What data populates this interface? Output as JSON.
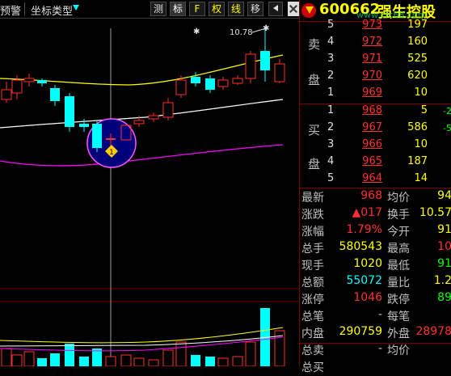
{
  "toolbar": {
    "alert_label": "预警",
    "coord_type_label": "坐标类型",
    "btn_measure": "测",
    "btn_mark": "标",
    "btn_f": "F",
    "btn_weight": "权",
    "btn_line": "线",
    "btn_move": "移"
  },
  "stock": {
    "code": "600662",
    "name": "强生控股"
  },
  "watermark": "www.cfc68.com",
  "order_book": {
    "sell_label_1": "卖",
    "sell_label_2": "盘",
    "buy_label_1": "买",
    "buy_label_2": "盘",
    "asks": [
      {
        "level": "5",
        "price": "973",
        "volume": "197",
        "change": ""
      },
      {
        "level": "4",
        "price": "972",
        "volume": "160",
        "change": ""
      },
      {
        "level": "3",
        "price": "971",
        "volume": "525",
        "change": ""
      },
      {
        "level": "2",
        "price": "970",
        "volume": "620",
        "change": ""
      },
      {
        "level": "1",
        "price": "969",
        "volume": "10",
        "change": ""
      }
    ],
    "bids": [
      {
        "level": "1",
        "price": "968",
        "volume": "5",
        "change": "-2"
      },
      {
        "level": "2",
        "price": "967",
        "volume": "586",
        "change": "-5"
      },
      {
        "level": "3",
        "price": "966",
        "volume": "10",
        "change": ""
      },
      {
        "level": "4",
        "price": "965",
        "volume": "187",
        "change": ""
      },
      {
        "level": "5",
        "price": "964",
        "volume": "14",
        "change": ""
      }
    ]
  },
  "stats": [
    {
      "l1": "最新",
      "v1": "968",
      "l2": "均价",
      "v2": "94"
    },
    {
      "l1": "涨跌",
      "v1": "▲017",
      "l2": "换手",
      "v2": "10.57"
    },
    {
      "l1": "涨幅",
      "v1": "1.79%",
      "l2": "今开",
      "v2": "91"
    },
    {
      "l1": "总手",
      "v1": "580543",
      "l2": "最高",
      "v2": "10"
    },
    {
      "l1": "现手",
      "v1": "1020",
      "l2": "最低",
      "v2": "91"
    },
    {
      "l1": "总额",
      "v1": "55072",
      "l2": "量比",
      "v2": "1.2"
    },
    {
      "l1": "涨停",
      "v1": "1046",
      "l2": "跌停",
      "v2": "89"
    },
    {
      "l1": "总笔",
      "v1": "-",
      "l2": "每笔",
      "v2": ""
    },
    {
      "l1": "内盘",
      "v1": "290759",
      "l2": "外盘",
      "v2": "28978"
    },
    {
      "l1": "总卖",
      "v1": "-",
      "l2": "均价",
      "v2": ""
    },
    {
      "l1": "总买",
      "v1": "",
      "l2": "",
      "v2": ""
    }
  ],
  "chart_data": {
    "type": "candlestick",
    "annotation_high": "10.78",
    "marker_label": "1",
    "colors": {
      "up": "#ff3030",
      "down": "#00ffff",
      "ma5": "#ffffff",
      "ma10": "#ffff00",
      "ma20": "#ff00ff"
    }
  }
}
